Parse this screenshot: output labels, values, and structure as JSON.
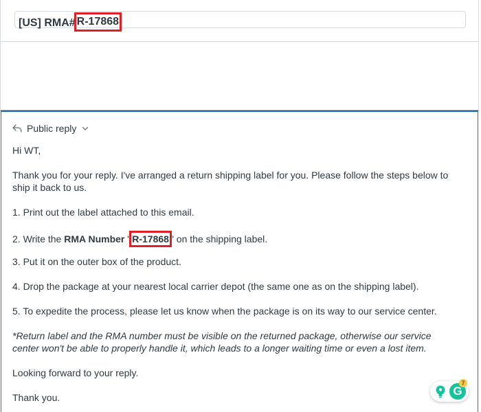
{
  "subject": {
    "prefix": "[US] RMA#",
    "rma_number": "R-17868"
  },
  "reply": {
    "mode_label": "Public reply",
    "greeting": "Hi WT,",
    "intro_line1": "Thank you for your reply. I've arranged a return shipping label for you. Please follow the steps below to",
    "intro_line2": "ship it back to us.",
    "step1": "1. Print out the label attached to this email.",
    "step2_prefix": "2. Write the ",
    "step2_bold": "RMA Number",
    "step2_quote_open": " \"",
    "step2_rma": "R-17868",
    "step2_quote_close": "\"",
    "step2_suffix": " on the shipping label.",
    "step3": "3. Put it on the outer box of the product.",
    "step4": "4. Drop the package at your nearest local carrier depot (the same one as on the shipping label).",
    "step5": "5. To expedite the process, please let us know when the package is on its way to our service center.",
    "note_line1": "*Return label and the RMA number must be visible on the returned package, otherwise our service",
    "note_line2": "center won't be able to properly handle it, which leads to a longer waiting time or even a lost item.",
    "closing": "Looking forward to your reply.",
    "signoff": "Thank you."
  },
  "grammarly": {
    "logo_letter": "G",
    "badge_count": "7",
    "brand_color": "#15c39a"
  },
  "colors": {
    "highlight": "#e01e24",
    "focus_border": "#1f73b7"
  }
}
